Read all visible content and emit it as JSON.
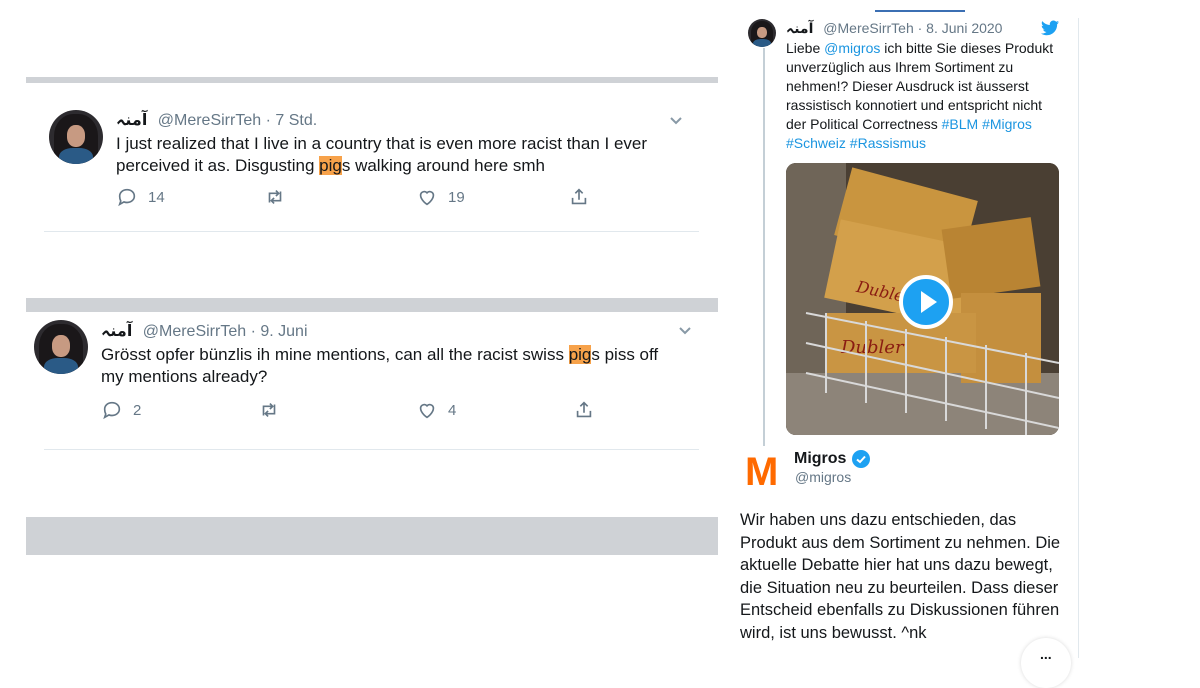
{
  "tweet1": {
    "display_name": "آمنہ",
    "handle": "@MereSirrTeh",
    "time": "· 7 Std.",
    "text_before": "I just realized that I live in a country that is even more racist than I ever perceived it as. Disgusting ",
    "text_highlight": "pig",
    "text_after": "s walking around here smh",
    "replies": "14",
    "retweets": "",
    "likes": "19"
  },
  "tweet2": {
    "display_name": "آمنہ",
    "handle": "@MereSirrTeh",
    "time": "· 9. Juni",
    "text_before": "Grösst opfer bünzlis ih mine mentions, can all the racist swiss ",
    "text_highlight": "pig",
    "text_after": "s piss off my mentions already?",
    "replies": "2",
    "retweets": "",
    "likes": "4"
  },
  "embed": {
    "display_name": "آمنہ",
    "handle": "@MereSirrTeh",
    "date": "· 8. Juni 2020",
    "text_1": "Liebe ",
    "mention": "@migros",
    "text_2": " ich bitte Sie dieses Produkt unverzüglich aus Ihrem Sortiment zu nehmen!? Dieser Ausdruck ist äusserst rassistisch konnotiert und entspricht nicht der Political Correctness ",
    "hashtags_1": "#BLM #Migros",
    "hashtags_2": "#Schweiz #Rassismus",
    "video_box_text_1": "Dubler",
    "video_box_text_2": "Dubler"
  },
  "reply": {
    "logo": "M",
    "name": "Migros",
    "handle": "@migros",
    "text": "Wir haben uns dazu entschieden, das Produkt aus dem Sortiment zu nehmen. Die aktuelle Debatte hier hat uns dazu bewegt, die Situation neu zu beurteilen. Dass dieser Entscheid ebenfalls zu Diskussionen führen wird, ist uns bewusst. ^nk",
    "more": "..."
  },
  "colors": {
    "highlight": "#f7a24a",
    "link": "#1b95e0",
    "migros_orange": "#ff6a00",
    "verified": "#1da1f2"
  }
}
